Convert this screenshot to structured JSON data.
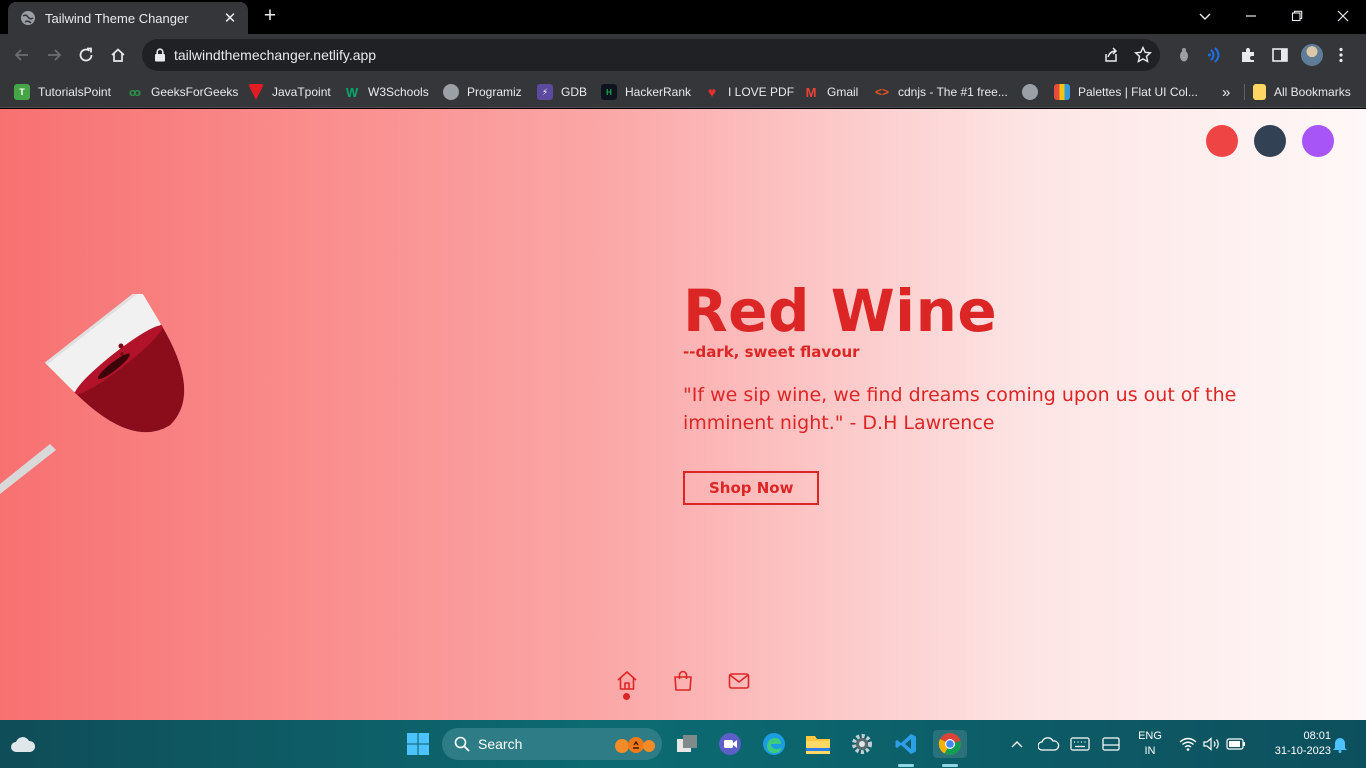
{
  "browser": {
    "tab_title": "Tailwind Theme Changer",
    "url": "tailwindthemechanger.netlify.app",
    "bookmarks": [
      {
        "label": "TutorialsPoint",
        "icon": "tutorialspoint-icon",
        "color": "#46a546"
      },
      {
        "label": "GeeksForGeeks",
        "icon": "geeksforgeeks-icon",
        "color": "#2f8d46"
      },
      {
        "label": "JavaTpoint",
        "icon": "javatpoint-icon",
        "color": "#e31b23"
      },
      {
        "label": "W3Schools",
        "icon": "w3schools-icon",
        "color": "#04aa6d"
      },
      {
        "label": "Programiz",
        "icon": "globe-icon",
        "color": "#9aa0a6"
      },
      {
        "label": "GDB",
        "icon": "gdb-icon",
        "color": "#5b4aa0"
      },
      {
        "label": "HackerRank",
        "icon": "hackerrank-icon",
        "color": "#1ba94c"
      },
      {
        "label": "I LOVE PDF",
        "icon": "ilovepdf-icon",
        "color": "#e5322d"
      },
      {
        "label": "Gmail",
        "icon": "gmail-icon",
        "color": "#ea4335"
      },
      {
        "label": "cdnjs - The #1 free...",
        "icon": "cdnjs-icon",
        "color": "#e95420"
      },
      {
        "label": "",
        "icon": "globe-icon",
        "color": "#9aa0a6"
      },
      {
        "label": "Palettes | Flat UI Col...",
        "icon": "flatuicolors-icon",
        "color": "#f1c40f"
      }
    ],
    "overflow_label": "»",
    "all_bookmarks": "All Bookmarks"
  },
  "page": {
    "theme_colors": [
      "#ef4444",
      "#334155",
      "#a855f7"
    ],
    "gradient_colors": [
      "#f87171",
      "#fff8f8"
    ],
    "accent_color": "#dc2626",
    "title": "Red Wine",
    "subtitle": "--dark, sweet flavour",
    "quote": "\"If we sip wine, we find dreams coming upon us out of the imminent night.\" - D.H Lawrence",
    "shop_button": "Shop Now",
    "nav": [
      {
        "icon": "home-icon",
        "active": true
      },
      {
        "icon": "shopping-bag-icon",
        "active": false
      },
      {
        "icon": "mail-icon",
        "active": false
      }
    ]
  },
  "taskbar": {
    "search_label": "Search",
    "language": "ENG",
    "region": "IN",
    "time": "08:01",
    "date": "31-10-2023"
  }
}
